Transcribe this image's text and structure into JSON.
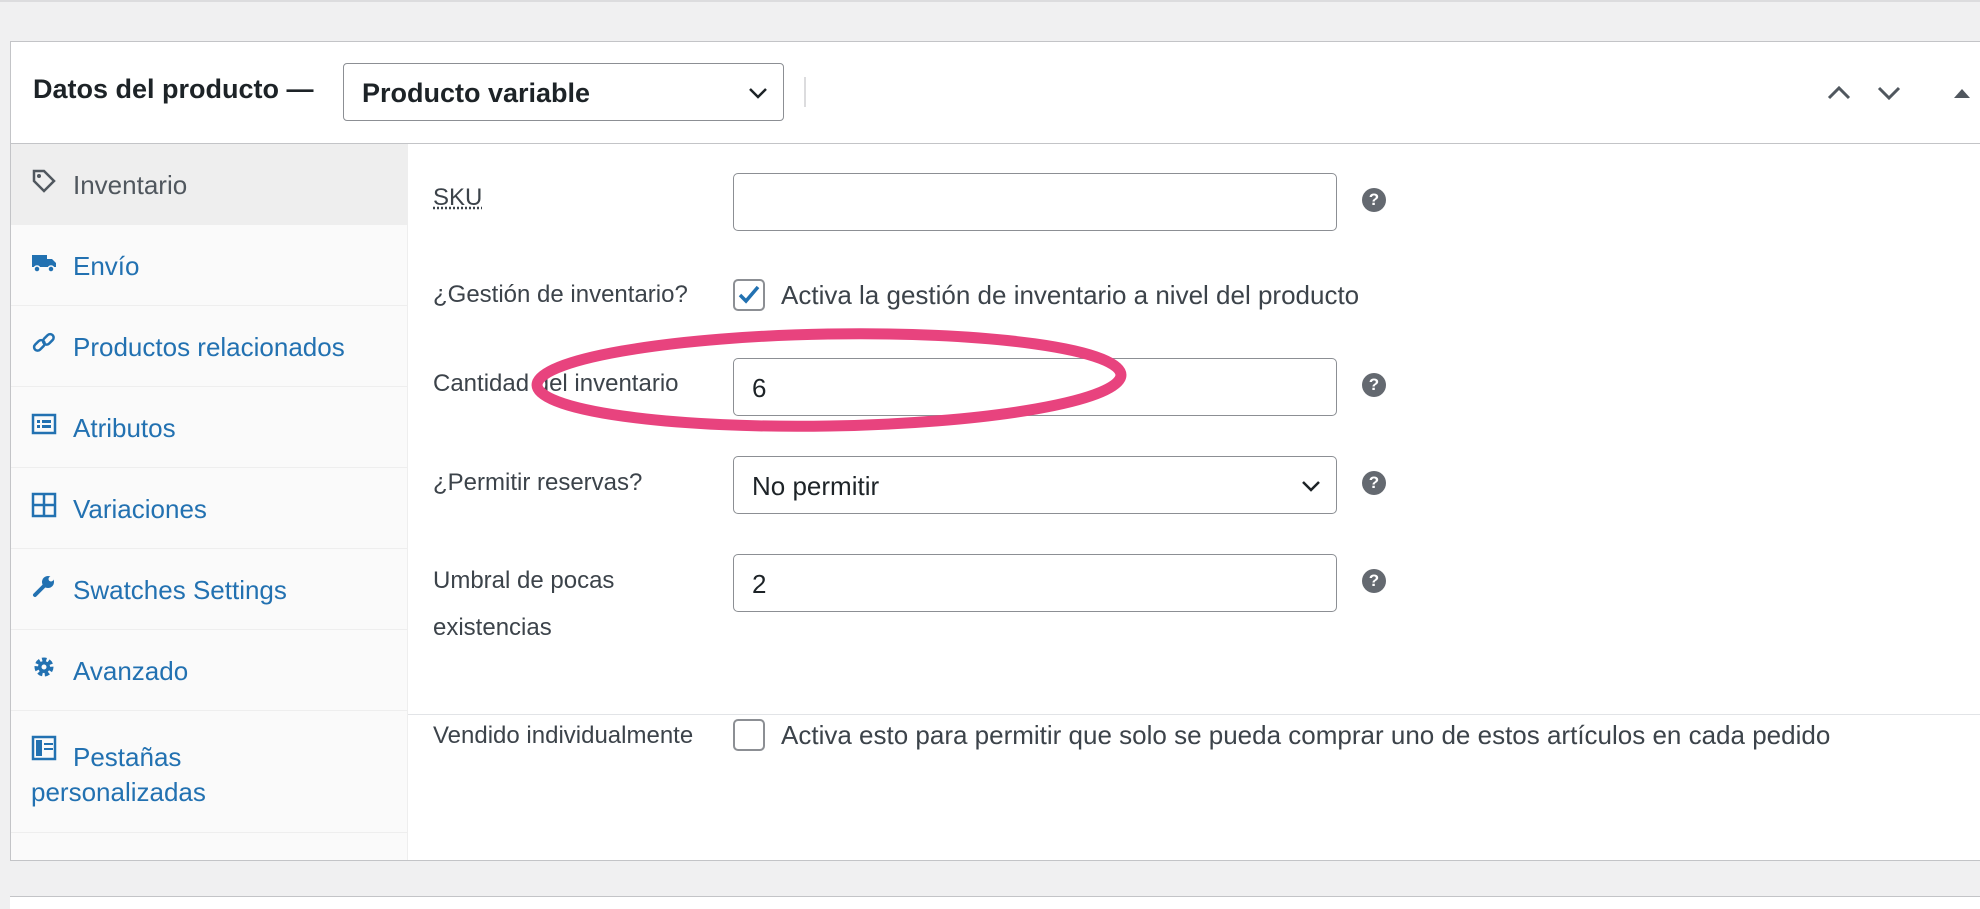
{
  "header": {
    "title": "Datos del producto —",
    "product_type": "Producto variable",
    "product_type_options": [
      "Producto variable"
    ]
  },
  "sidebar": {
    "items": [
      {
        "label": "Inventario",
        "icon": "tag-icon",
        "active": true
      },
      {
        "label": "Envío",
        "icon": "truck-icon"
      },
      {
        "label": "Productos relacionados",
        "icon": "link-icon"
      },
      {
        "label": "Atributos",
        "icon": "list-icon"
      },
      {
        "label": "Variaciones",
        "icon": "grid-icon"
      },
      {
        "label": "Swatches Settings",
        "icon": "wrench-icon"
      },
      {
        "label": "Avanzado",
        "icon": "gear-icon"
      },
      {
        "label_line1": "Pestañas",
        "label_line2": "personalizadas",
        "icon": "tabs-icon"
      }
    ]
  },
  "inventory": {
    "sku_label": "SKU",
    "sku_value": "",
    "manage_stock_label": "¿Gestión de inventario?",
    "manage_stock_checked": true,
    "manage_stock_desc": "Activa la gestión de inventario a nivel del producto",
    "quantity_label": "Cantidad del inventario",
    "quantity_value": "6",
    "backorders_label": "¿Permitir reservas?",
    "backorders_value": "No permitir",
    "low_stock_label_line1": "Umbral de pocas",
    "low_stock_label_line2": "existencias",
    "low_stock_value": "2",
    "sold_individually_label": "Vendido individualmente",
    "sold_individually_checked": false,
    "sold_individually_desc": "Activa esto para permitir que solo se pueda comprar uno de estos artículos en cada pedido"
  },
  "colors": {
    "link": "#2271b1",
    "highlight_ring": "#e8437e",
    "checkbox_check": "#2271b1"
  }
}
